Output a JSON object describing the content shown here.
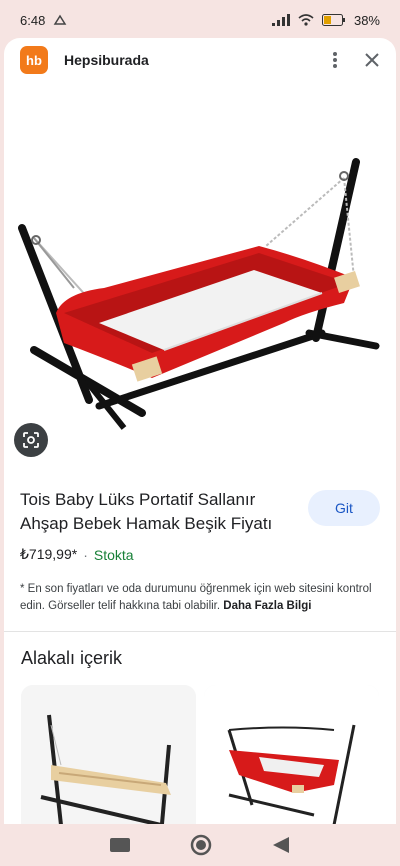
{
  "status_bar": {
    "time": "6:48",
    "battery": "38%"
  },
  "header": {
    "site_name": "Hepsiburada",
    "logo_text": "hb"
  },
  "product": {
    "title": "Tois Baby Lüks Portatif Sallanır Ahşap Bebek Hamak Beşik Fiyatı",
    "price": "₺719,99*",
    "separator": "·",
    "stock": "Stokta",
    "go_button": "Git",
    "disclaimer": "* En son fiyatları ve oda durumunu öğrenmek için web sitesini kontrol edin. Görseller telif hakkına tabi olabilir.",
    "more_link": "Daha Fazla Bilgi"
  },
  "related": {
    "title": "Alakalı içerik"
  },
  "colors": {
    "brand_orange": "#f27a1a",
    "stock_green": "#188038",
    "button_blue_bg": "#e8f0fe",
    "cradle_red": "#d71a1a"
  }
}
